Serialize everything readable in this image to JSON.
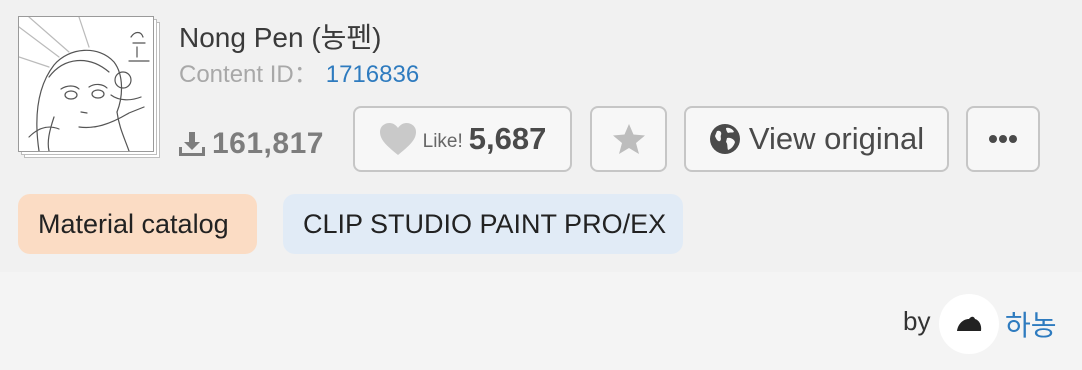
{
  "content": {
    "title": "Nong Pen (농펜)",
    "content_id_label": "Content ID：",
    "content_id_value": "1716836",
    "thumbnail_icon": "sketch-illustration-thumbnail"
  },
  "stats": {
    "downloads": "161,817",
    "download_icon": "download-icon"
  },
  "actions": {
    "like_label": "Like!",
    "like_count": "5,687",
    "like_icon": "heart-icon",
    "favorite_icon": "star-icon",
    "view_original_label": "View original",
    "view_original_icon": "globe-icon",
    "more_label": "•••"
  },
  "tags": {
    "category": "Material catalog",
    "software": "CLIP STUDIO PAINT PRO/EX"
  },
  "author": {
    "by_label": "by",
    "name": "하농"
  },
  "colors": {
    "link": "#2e7bbf",
    "category_tag_bg": "#fbdcc4",
    "software_tag_bg": "#e1ebf6"
  }
}
